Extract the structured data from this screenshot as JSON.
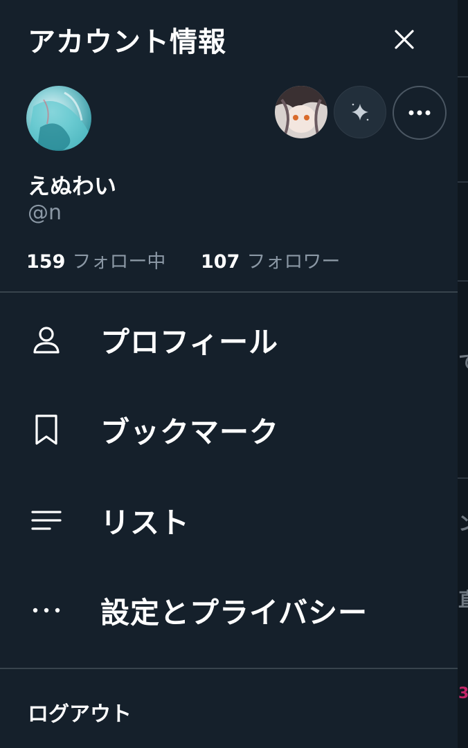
{
  "drawer": {
    "title": "アカウント情報"
  },
  "profile": {
    "name": "えぬわい",
    "handle": "@n",
    "following_count": "159",
    "following_label": "フォロー中",
    "followers_count": "107",
    "followers_label": "フォロワー"
  },
  "menu": {
    "items": [
      {
        "label": "プロフィール",
        "icon": "person-icon"
      },
      {
        "label": "ブックマーク",
        "icon": "bookmark-icon"
      },
      {
        "label": "リスト",
        "icon": "list-icon"
      },
      {
        "label": "設定とプライバシー",
        "icon": "more-dots-icon"
      }
    ]
  },
  "footer": {
    "logout_label": "ログアウト"
  },
  "colors": {
    "background": "#15202b",
    "secondary_text": "#8b98a5",
    "divider": "#38444d",
    "text": "#ffffff"
  }
}
